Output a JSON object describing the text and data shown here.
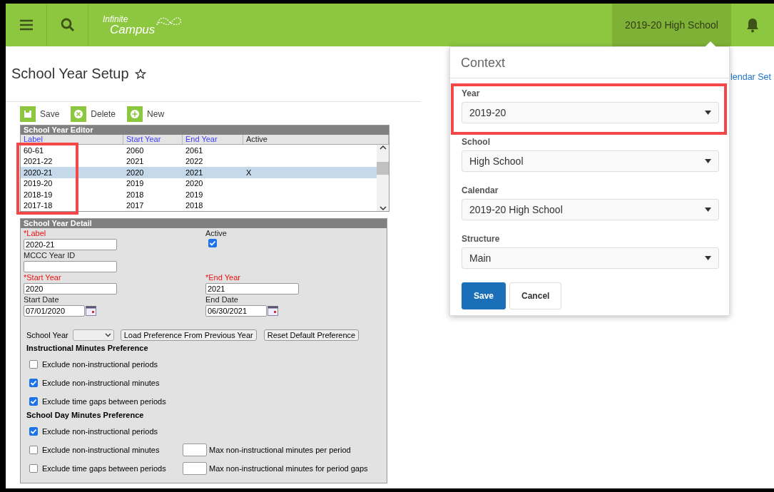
{
  "header": {
    "logo": [
      "Infinite",
      "Campus"
    ],
    "context_button": "2019-20 High School"
  },
  "page": {
    "title": "School Year Setup",
    "favorite": false,
    "link": "lendar Set"
  },
  "toolbar": [
    {
      "kind": "save",
      "label": "Save"
    },
    {
      "kind": "delete",
      "label": "Delete"
    },
    {
      "kind": "new",
      "label": "New"
    }
  ],
  "editor": {
    "title": "School Year Editor",
    "columns": [
      "Label",
      "Start Year",
      "End Year",
      "Active"
    ],
    "rows": [
      {
        "label": "60-61",
        "start": "2060",
        "end": "2061",
        "selected": false
      },
      {
        "label": "2021-22",
        "start": "2021",
        "end": "2022",
        "selected": false
      },
      {
        "label": "2020-21",
        "start": "2020",
        "end": "2021",
        "active": "X",
        "selected": true
      },
      {
        "label": "2019-20",
        "start": "2019",
        "end": "2020",
        "selected": false
      },
      {
        "label": "2018-19",
        "start": "2018",
        "end": "2019",
        "selected": false
      },
      {
        "label": "2017-18",
        "start": "2017",
        "end": "2018",
        "selected": false
      }
    ]
  },
  "detail": {
    "title": "School Year Detail",
    "label": {
      "label": "*Label",
      "required": true,
      "value": "2020-21"
    },
    "active": {
      "label": "Active",
      "checked": true
    },
    "mccc": {
      "label": "MCCC Year ID",
      "required": false
    },
    "start_year": {
      "label": "*Start Year",
      "required": true,
      "value": "2020"
    },
    "end_year": {
      "label": "*End Year",
      "required": true,
      "value": "2021"
    },
    "start_date": {
      "label": "Start Date",
      "required": false,
      "value": "07/01/2020"
    },
    "end_date": {
      "label": "End Date",
      "required": false,
      "value": "06/30/2021"
    },
    "school_year": {
      "label": "School Year"
    },
    "buttons": [
      "Load Preference From Previous Year",
      "Reset Default Preference"
    ],
    "sections": [
      {
        "title": "Instructional Minutes Preference",
        "options": [
          {
            "label": "Exclude non-instructional periods",
            "checked": false
          },
          {
            "label": "Exclude non-instructional minutes",
            "checked": true
          },
          {
            "label": "Exclude time gaps between periods",
            "checked": true
          }
        ]
      },
      {
        "title": "School Day Minutes Preference",
        "options": [
          {
            "label": "Exclude non-instructional periods",
            "checked": true
          },
          {
            "label": "Exclude non-instructional minutes",
            "checked": false,
            "max_label": "Max non-instructional minutes per period"
          },
          {
            "label": "Exclude time gaps between periods",
            "checked": false,
            "max_label": "Max non-instructional minutes for period gaps"
          }
        ]
      }
    ]
  },
  "context": {
    "title": "Context",
    "fields": [
      {
        "label": "Year",
        "value": "2019-20"
      },
      {
        "label": "School",
        "value": "High School"
      },
      {
        "label": "Calendar",
        "value": "2019-20 High School"
      },
      {
        "label": "Structure",
        "value": "Main"
      }
    ],
    "buttons": [
      {
        "kind": "primary",
        "label": "Save"
      },
      {
        "kind": "secondary",
        "label": "Cancel"
      }
    ]
  }
}
